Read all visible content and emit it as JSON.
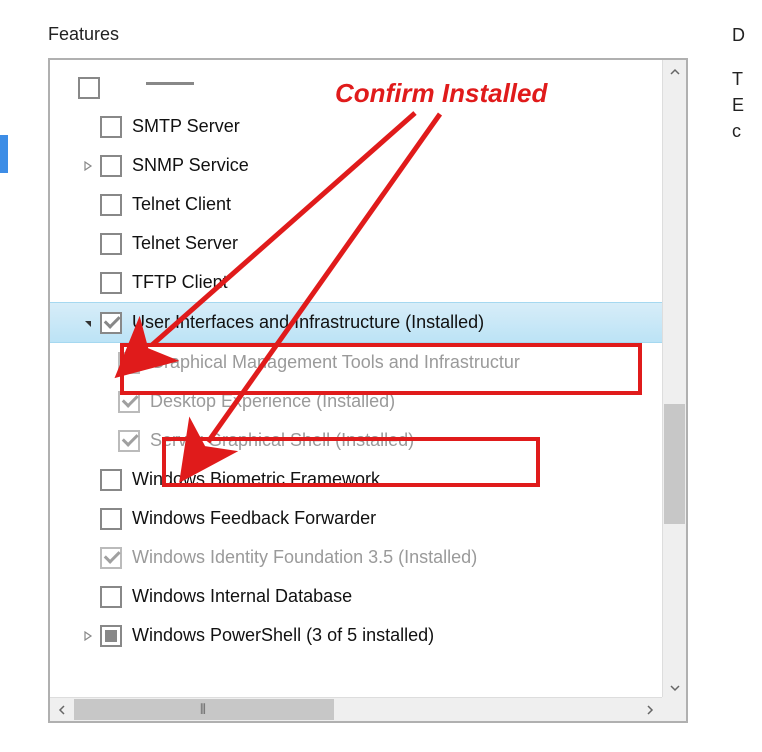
{
  "header": "Features",
  "right_sidebar_chars": [
    "D",
    "T",
    "E",
    "c"
  ],
  "annotation": "Confirm Installed",
  "items": [
    {
      "id": "partial-top",
      "indent": 1,
      "expander": null,
      "checkbox": "unchecked",
      "label": "",
      "partial_line": true
    },
    {
      "id": "smtp-server",
      "indent": 1,
      "expander": "spacer",
      "checkbox": "unchecked",
      "label": "SMTP Server"
    },
    {
      "id": "snmp-service",
      "indent": 1,
      "expander": "collapsed",
      "checkbox": "unchecked",
      "label": "SNMP Service"
    },
    {
      "id": "telnet-client",
      "indent": 1,
      "expander": "spacer",
      "checkbox": "unchecked",
      "label": "Telnet Client"
    },
    {
      "id": "telnet-server",
      "indent": 1,
      "expander": "spacer",
      "checkbox": "unchecked",
      "label": "Telnet Server"
    },
    {
      "id": "tftp-client",
      "indent": 1,
      "expander": "spacer",
      "checkbox": "unchecked",
      "label": "TFTP Client"
    },
    {
      "id": "user-interfaces-infrastructure",
      "indent": 1,
      "expander": "expanded",
      "checkbox": "checked",
      "label": "User Interfaces and Infrastructure (Installed)",
      "selected": true
    },
    {
      "id": "graphical-management-tools",
      "indent": 2,
      "expander": null,
      "checkbox": "checked-disabled",
      "label": "Graphical Management Tools and Infrastructur",
      "disabled": true
    },
    {
      "id": "desktop-experience",
      "indent": 2,
      "expander": null,
      "checkbox": "checked-disabled",
      "label": "Desktop Experience (Installed)",
      "disabled": true
    },
    {
      "id": "server-graphical-shell",
      "indent": 2,
      "expander": null,
      "checkbox": "checked-disabled",
      "label": "Server Graphical Shell (Installed)",
      "disabled": true
    },
    {
      "id": "windows-biometric-framework",
      "indent": 1,
      "expander": "spacer",
      "checkbox": "unchecked",
      "label": "Windows Biometric Framework"
    },
    {
      "id": "windows-feedback-forwarder",
      "indent": 1,
      "expander": "spacer",
      "checkbox": "unchecked",
      "label": "Windows Feedback Forwarder"
    },
    {
      "id": "windows-identity-foundation",
      "indent": 1,
      "expander": "spacer",
      "checkbox": "checked-disabled",
      "label": "Windows Identity Foundation 3.5 (Installed)",
      "disabled": true
    },
    {
      "id": "windows-internal-database",
      "indent": 1,
      "expander": "spacer",
      "checkbox": "unchecked",
      "label": "Windows Internal Database"
    },
    {
      "id": "windows-powershell",
      "indent": 1,
      "expander": "collapsed",
      "checkbox": "indeterminate",
      "label": "Windows PowerShell (3 of 5 installed)"
    }
  ]
}
